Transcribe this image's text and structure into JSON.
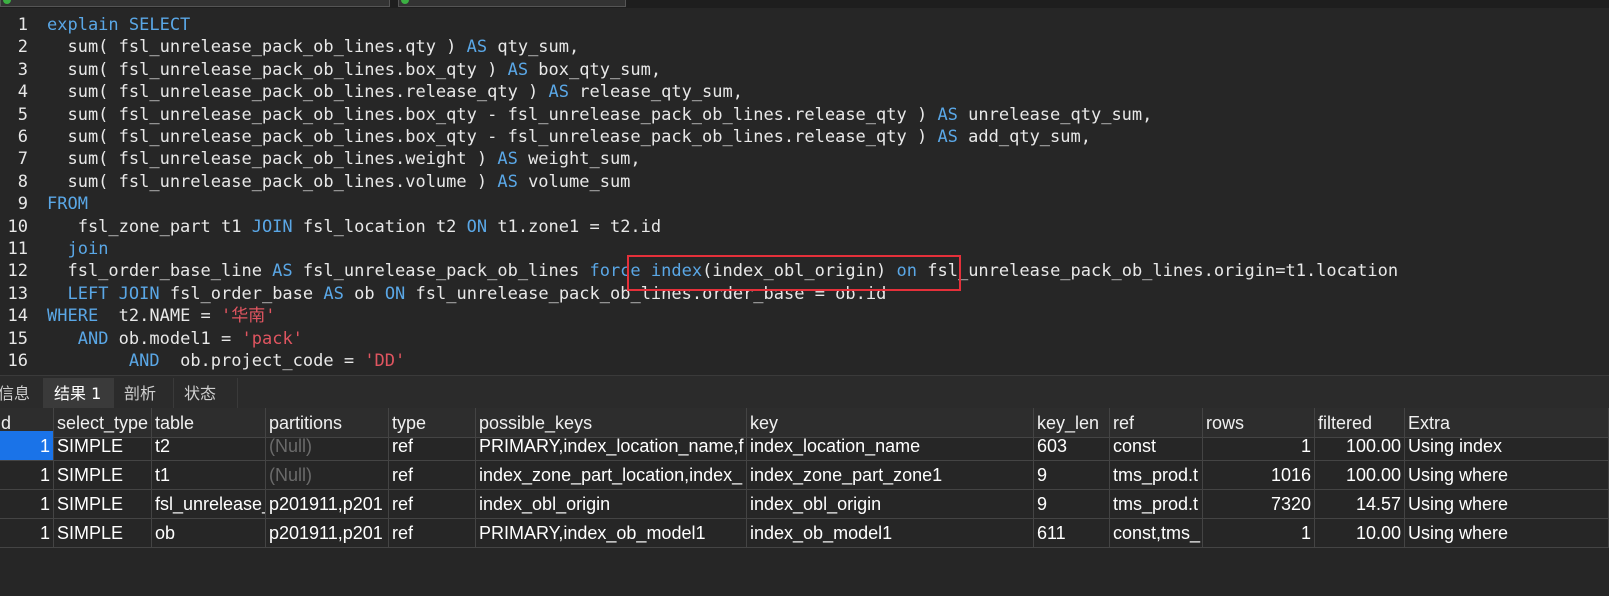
{
  "editor": {
    "lines": [
      {
        "n": "1",
        "parts": [
          {
            "t": "explain SELECT",
            "c": "kw"
          }
        ]
      },
      {
        "n": "2",
        "parts": [
          {
            "t": "  sum( fsl_unrelease_pack_ob_lines.qty ) "
          },
          {
            "t": "AS",
            "c": "kw"
          },
          {
            "t": " qty_sum,"
          }
        ]
      },
      {
        "n": "3",
        "parts": [
          {
            "t": "  sum( fsl_unrelease_pack_ob_lines.box_qty ) "
          },
          {
            "t": "AS",
            "c": "kw"
          },
          {
            "t": " box_qty_sum,"
          }
        ]
      },
      {
        "n": "4",
        "parts": [
          {
            "t": "  sum( fsl_unrelease_pack_ob_lines.release_qty ) "
          },
          {
            "t": "AS",
            "c": "kw"
          },
          {
            "t": " release_qty_sum,"
          }
        ]
      },
      {
        "n": "5",
        "parts": [
          {
            "t": "  sum( fsl_unrelease_pack_ob_lines.box_qty - fsl_unrelease_pack_ob_lines.release_qty ) "
          },
          {
            "t": "AS",
            "c": "kw"
          },
          {
            "t": " unrelease_qty_sum,"
          }
        ]
      },
      {
        "n": "6",
        "parts": [
          {
            "t": "  sum( fsl_unrelease_pack_ob_lines.box_qty - fsl_unrelease_pack_ob_lines.release_qty ) "
          },
          {
            "t": "AS",
            "c": "kw"
          },
          {
            "t": " add_qty_sum,"
          }
        ]
      },
      {
        "n": "7",
        "parts": [
          {
            "t": "  sum( fsl_unrelease_pack_ob_lines.weight ) "
          },
          {
            "t": "AS",
            "c": "kw"
          },
          {
            "t": " weight_sum,"
          }
        ]
      },
      {
        "n": "8",
        "parts": [
          {
            "t": "  sum( fsl_unrelease_pack_ob_lines.volume ) "
          },
          {
            "t": "AS",
            "c": "kw"
          },
          {
            "t": " volume_sum"
          }
        ]
      },
      {
        "n": "9",
        "parts": [
          {
            "t": "FROM",
            "c": "kw"
          }
        ]
      },
      {
        "n": "10",
        "parts": [
          {
            "t": "   fsl_zone_part t1 "
          },
          {
            "t": "JOIN",
            "c": "kw"
          },
          {
            "t": " fsl_location t2 "
          },
          {
            "t": "ON",
            "c": "kw"
          },
          {
            "t": " t1.zone1 = t2.id"
          }
        ]
      },
      {
        "n": "11",
        "parts": [
          {
            "t": "  "
          },
          {
            "t": "join",
            "c": "kw"
          }
        ]
      },
      {
        "n": "12",
        "parts": [
          {
            "t": "  fsl_order_base_line "
          },
          {
            "t": "AS",
            "c": "kw"
          },
          {
            "t": " fsl_unrelease_pack_ob_lines "
          },
          {
            "t": "force index",
            "c": "kw"
          },
          {
            "t": "(index_obl_origin) "
          },
          {
            "t": "on",
            "c": "kw"
          },
          {
            "t": " fsl_unrelease_pack_ob_lines.origin=t1.location"
          }
        ]
      },
      {
        "n": "13",
        "parts": [
          {
            "t": "  "
          },
          {
            "t": "LEFT JOIN",
            "c": "kw"
          },
          {
            "t": " fsl_order_base "
          },
          {
            "t": "AS",
            "c": "kw"
          },
          {
            "t": " ob "
          },
          {
            "t": "ON",
            "c": "kw"
          },
          {
            "t": " fsl_unrelease_pack_ob_lines.order_base = ob.id"
          }
        ]
      },
      {
        "n": "14",
        "parts": [
          {
            "t": "WHERE",
            "c": "kw"
          },
          {
            "t": "  t2.NAME = "
          },
          {
            "t": "'华南'",
            "c": "str"
          }
        ]
      },
      {
        "n": "15",
        "parts": [
          {
            "t": "   "
          },
          {
            "t": "AND",
            "c": "kw"
          },
          {
            "t": " ob.model1 = "
          },
          {
            "t": "'pack'",
            "c": "str"
          }
        ]
      },
      {
        "n": "16",
        "parts": [
          {
            "t": "        "
          },
          {
            "t": "AND",
            "c": "kw"
          },
          {
            "t": "  ob.project_code = "
          },
          {
            "t": "'DD'",
            "c": "str"
          }
        ]
      }
    ]
  },
  "tabs": [
    "信息",
    "结果 1",
    "剖析",
    "状态"
  ],
  "grid": {
    "columns": [
      "id",
      "select_type",
      "table",
      "partitions",
      "type",
      "possible_keys",
      "key",
      "key_len",
      "ref",
      "rows",
      "filtered",
      "Extra"
    ],
    "rows": [
      [
        "1",
        "SIMPLE",
        "t2",
        "(Null)",
        "ref",
        "PRIMARY,index_location_name,f",
        "index_location_name",
        "603",
        "const",
        "1",
        "100.00",
        "Using index"
      ],
      [
        "1",
        "SIMPLE",
        "t1",
        "(Null)",
        "ref",
        "index_zone_part_location,index_",
        "index_zone_part_zone1",
        "9",
        "tms_prod.t",
        "1016",
        "100.00",
        "Using where"
      ],
      [
        "1",
        "SIMPLE",
        "fsl_unrelease_",
        "p201911,p201",
        "ref",
        "index_obl_origin",
        "index_obl_origin",
        "9",
        "tms_prod.t",
        "7320",
        "14.57",
        "Using where"
      ],
      [
        "1",
        "SIMPLE",
        "ob",
        "p201911,p201",
        "ref",
        "PRIMARY,index_ob_model1",
        "index_ob_model1",
        "611",
        "const,tms_",
        "1",
        "10.00",
        "Using where"
      ]
    ]
  }
}
